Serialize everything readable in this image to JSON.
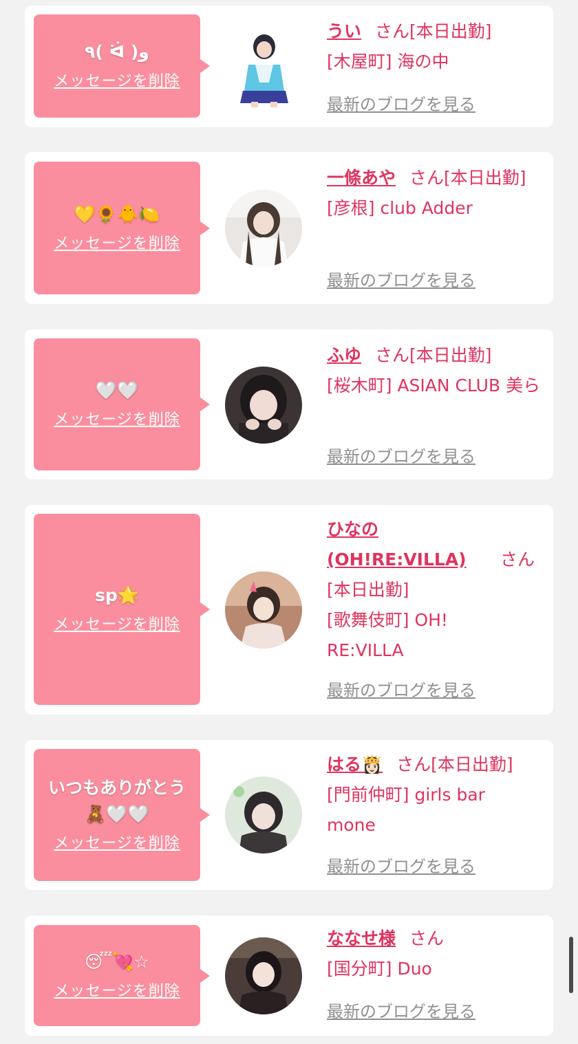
{
  "cards": [
    {
      "message": "٩( ᐛ )و",
      "delete_label": "メッセージを削除",
      "name": "うい",
      "honorific": "さん",
      "status": "[本日出勤]",
      "location": "[木屋町] 海の中",
      "blog_label": "最新のブログを見る"
    },
    {
      "message": "💛🌻🐥🍋",
      "delete_label": "メッセージを削除",
      "name": "一條あや",
      "honorific": "さん",
      "status": "[本日出勤]",
      "location": "[彦根] club Adder",
      "blog_label": "最新のブログを見る"
    },
    {
      "message": "🤍🤍",
      "delete_label": "メッセージを削除",
      "name": "ふゆ",
      "honorific": "さん",
      "status": "[本日出勤]",
      "location": "[桜木町] ASIAN CLUB 美ら",
      "blog_label": "最新のブログを見る"
    },
    {
      "message": "sp🌟",
      "delete_label": "メッセージを削除",
      "name": "ひなの (OH!RE:VILLA)",
      "honorific": "さん",
      "status": "[本日出勤]",
      "location": "[歌舞伎町] OH! RE:VILLA",
      "blog_label": "最新のブログを見る"
    },
    {
      "message": "いつもありがとう🧸🤍🤍",
      "delete_label": "メッセージを削除",
      "name": "はる👸🏻",
      "honorific": "さん",
      "status": "[本日出勤]",
      "location": "[門前仲町] girls bar mone",
      "blog_label": "最新のブログを見る"
    },
    {
      "message": "😴💘☆",
      "delete_label": "メッセージを削除",
      "name": "ななせ様",
      "honorific": "さん",
      "status": "",
      "location": "[国分町] Duo",
      "blog_label": "最新のブログを見る"
    }
  ],
  "colors": {
    "bubble": "#fb8e9e",
    "accent": "#e0335e",
    "link_gray": "#909090",
    "background": "#f2f2f2"
  }
}
